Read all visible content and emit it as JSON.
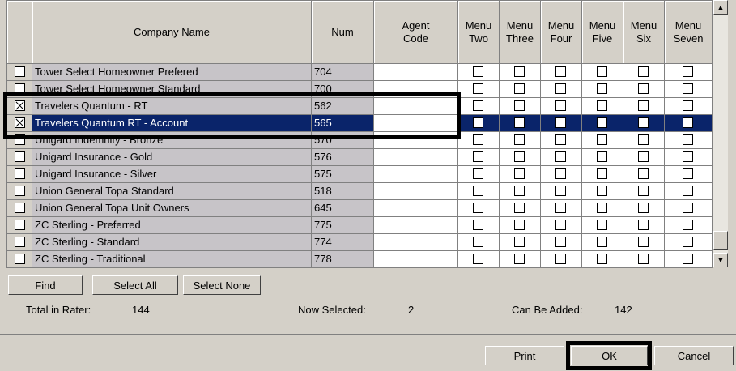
{
  "columns": {
    "company_name": "Company Name",
    "num": "Num",
    "agent_code": "Agent\nCode",
    "menus": [
      "Menu\nTwo",
      "Menu\nThree",
      "Menu\nFour",
      "Menu\nFive",
      "Menu\nSix",
      "Menu\nSeven"
    ]
  },
  "rows": [
    {
      "name": "Tower Select Homeowner Prefered",
      "num": "704",
      "selected": false,
      "checked": false
    },
    {
      "name": "Tower Select Homeowner Standard",
      "num": "700",
      "selected": false,
      "checked": false
    },
    {
      "name": "Travelers Quantum - RT",
      "num": "562",
      "selected": false,
      "checked": true
    },
    {
      "name": "Travelers Quantum RT - Account",
      "num": "565",
      "selected": true,
      "checked": true
    },
    {
      "name": "Unigard Indemnity - Bronze",
      "num": "570",
      "selected": false,
      "checked": false
    },
    {
      "name": "Unigard Insurance - Gold",
      "num": "576",
      "selected": false,
      "checked": false
    },
    {
      "name": "Unigard Insurance - Silver",
      "num": "575",
      "selected": false,
      "checked": false
    },
    {
      "name": "Union General Topa Standard",
      "num": "518",
      "selected": false,
      "checked": false
    },
    {
      "name": "Union General Topa Unit Owners",
      "num": "645",
      "selected": false,
      "checked": false
    },
    {
      "name": "ZC Sterling - Preferred",
      "num": "775",
      "selected": false,
      "checked": false
    },
    {
      "name": "ZC Sterling - Standard",
      "num": "774",
      "selected": false,
      "checked": false
    },
    {
      "name": "ZC Sterling - Traditional",
      "num": "778",
      "selected": false,
      "checked": false
    }
  ],
  "buttons": {
    "find": "Find",
    "select_all": "Select All",
    "select_none": "Select None",
    "print": "Print",
    "ok": "OK",
    "cancel": "Cancel"
  },
  "stats": {
    "total_label": "Total in Rater:",
    "total_value": "144",
    "selected_label": "Now Selected:",
    "selected_value": "2",
    "can_add_label": "Can Be Added:",
    "can_add_value": "142"
  },
  "icons": {
    "scroll_up": "up-arrow-icon",
    "scroll_down": "down-arrow-icon"
  },
  "colors": {
    "selection": "#0a246a",
    "locked_cell": "#c7c4c8",
    "window": "#d4d0c8"
  }
}
